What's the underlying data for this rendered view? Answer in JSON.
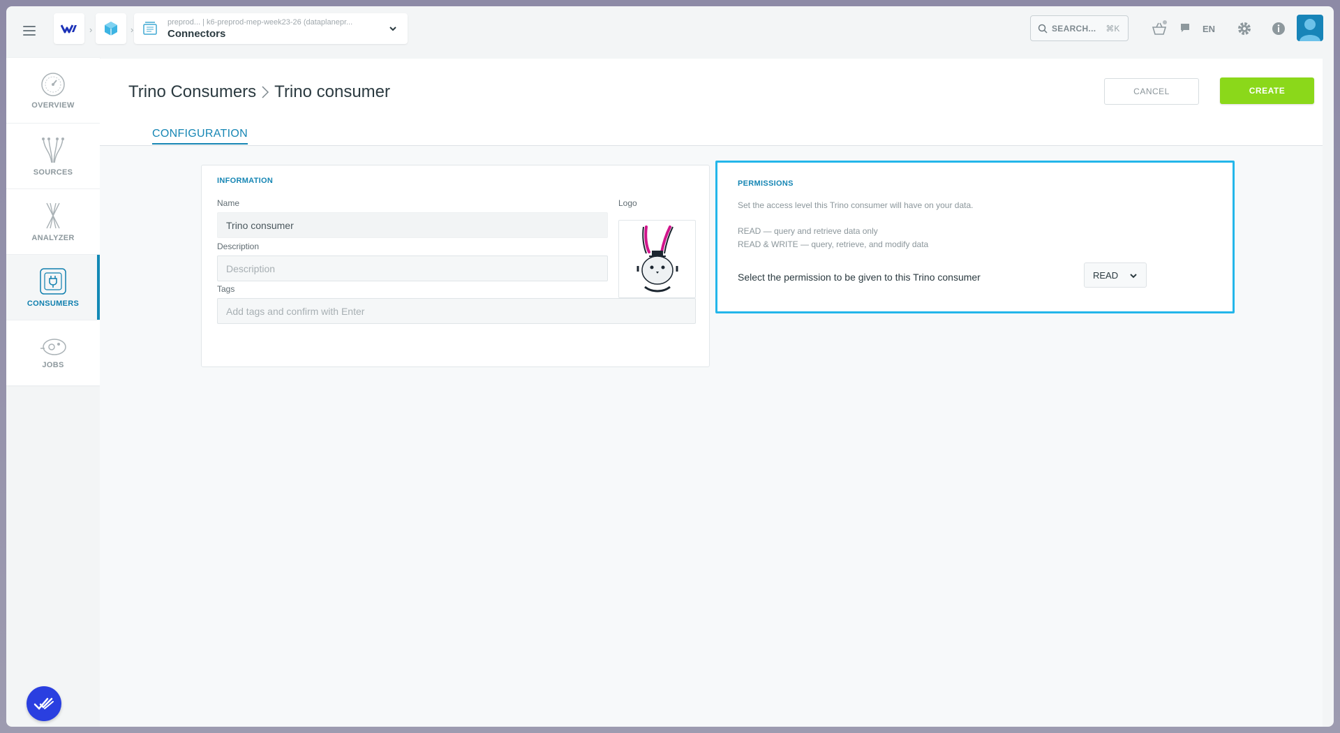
{
  "topbar": {
    "project_path": "preprod... | k6-preprod-mep-week23-26 (dataplanepr...",
    "project_name": "Connectors",
    "search_label": "SEARCH...",
    "search_shortcut": "⌘K",
    "language": "EN"
  },
  "sidebar": {
    "items": [
      {
        "label": "OVERVIEW",
        "icon": "gauge-icon"
      },
      {
        "label": "SOURCES",
        "icon": "sources-icon"
      },
      {
        "label": "ANALYZER",
        "icon": "analyzer-icon"
      },
      {
        "label": "CONSUMERS",
        "icon": "consumers-plug-icon",
        "active": true
      },
      {
        "label": "JOBS",
        "icon": "jobs-icon"
      }
    ]
  },
  "header": {
    "breadcrumb_parent": "Trino Consumers",
    "breadcrumb_current": "Trino consumer",
    "cancel_label": "CANCEL",
    "create_label": "CREATE",
    "tab_label": "CONFIGURATION"
  },
  "information": {
    "title": "INFORMATION",
    "name_label": "Name",
    "name_value": "Trino consumer",
    "logo_label": "Logo",
    "description_label": "Description",
    "description_placeholder": "Description",
    "tags_label": "Tags",
    "tags_placeholder": "Add tags and confirm with Enter"
  },
  "permissions": {
    "title": "PERMISSIONS",
    "intro": "Set the access level this Trino consumer will have on your data.",
    "read_desc": "READ — query and retrieve data only",
    "readwrite_desc": "READ & WRITE — query, retrieve, and modify data",
    "select_label": "Select the permission to be given to this Trino consumer",
    "selected_value": "READ"
  },
  "colors": {
    "accent": "#1686b4",
    "create_button": "#8bd81a",
    "highlight_border": "#23b6ea",
    "help_bubble": "#2a3fe0"
  }
}
